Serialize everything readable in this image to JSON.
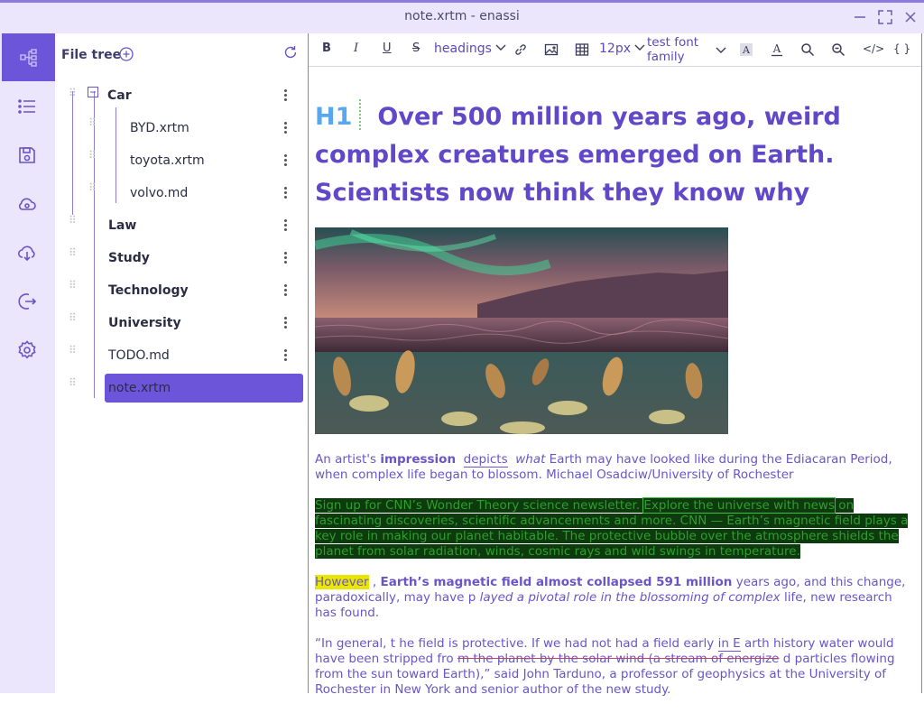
{
  "window": {
    "title": "note.xrtm - enassi"
  },
  "sidebar": {
    "title": "File tree"
  },
  "tree": [
    {
      "label": "Car",
      "bold": true
    },
    {
      "label": "BYD.xrtm",
      "bold": false
    },
    {
      "label": "toyota.xrtm",
      "bold": false
    },
    {
      "label": "volvo.md",
      "bold": false
    },
    {
      "label": "Law",
      "bold": true
    },
    {
      "label": "Study",
      "bold": true
    },
    {
      "label": "Technology",
      "bold": true
    },
    {
      "label": "University",
      "bold": true
    },
    {
      "label": "TODO.md",
      "bold": false
    },
    {
      "label": "note.xrtm",
      "bold": false,
      "selected": true
    }
  ],
  "toolbar": {
    "bold": "B",
    "italic": "I",
    "underline": "U",
    "strike": "S",
    "headings": "headings",
    "font_size": "12px",
    "font_family": "test font family",
    "code": "</>",
    "braces": "{ }"
  },
  "editor": {
    "heading_tag": "H1",
    "heading": "Over 500 million years ago, weird complex creatures emerged on Earth. Scientists now think they know why",
    "caption": {
      "t1": "An artist's ",
      "t2": "impression",
      "t3": "depicts",
      "t4": "what",
      "t5": " Earth may have looked like during the Ediacaran Period, when complex life began to blossom. Michael Osadciw/University of Rochester"
    },
    "p1": {
      "t1": "Sign up for CNN’s Wonder Theory science newsletter. ",
      "t2": "Explore the universe with news",
      "t3": " on fascinating discoveries, scientific advancements and more. CNN — Earth’s magnetic field plays a key role in making our planet habitable. The protective bubble over the atmosphere shields the planet from solar radiation, winds, cosmic rays and wild swings in temperature."
    },
    "p2": {
      "t1": "However",
      "t2": " , ",
      "t3": "Earth’s magnetic field almost collapsed 591 million",
      "t4": " years ago, and this change, paradoxically, may have p ",
      "t5": "layed a pivotal role in the blossoming of complex",
      "t6": " life, new research has found."
    },
    "p3": {
      "t1": "“In general, t he field is protective. If we had not had a field early ",
      "t2": "in E",
      "t3": " arth history water would have been stripped fro ",
      "t4": "m the planet by the solar wind (a stream of energize",
      "t5": " d particles flowing from the sun toward Earth),” said John Tarduno, a professor of geophysics at the University of Rochester in New York and senior author of the new study."
    }
  }
}
